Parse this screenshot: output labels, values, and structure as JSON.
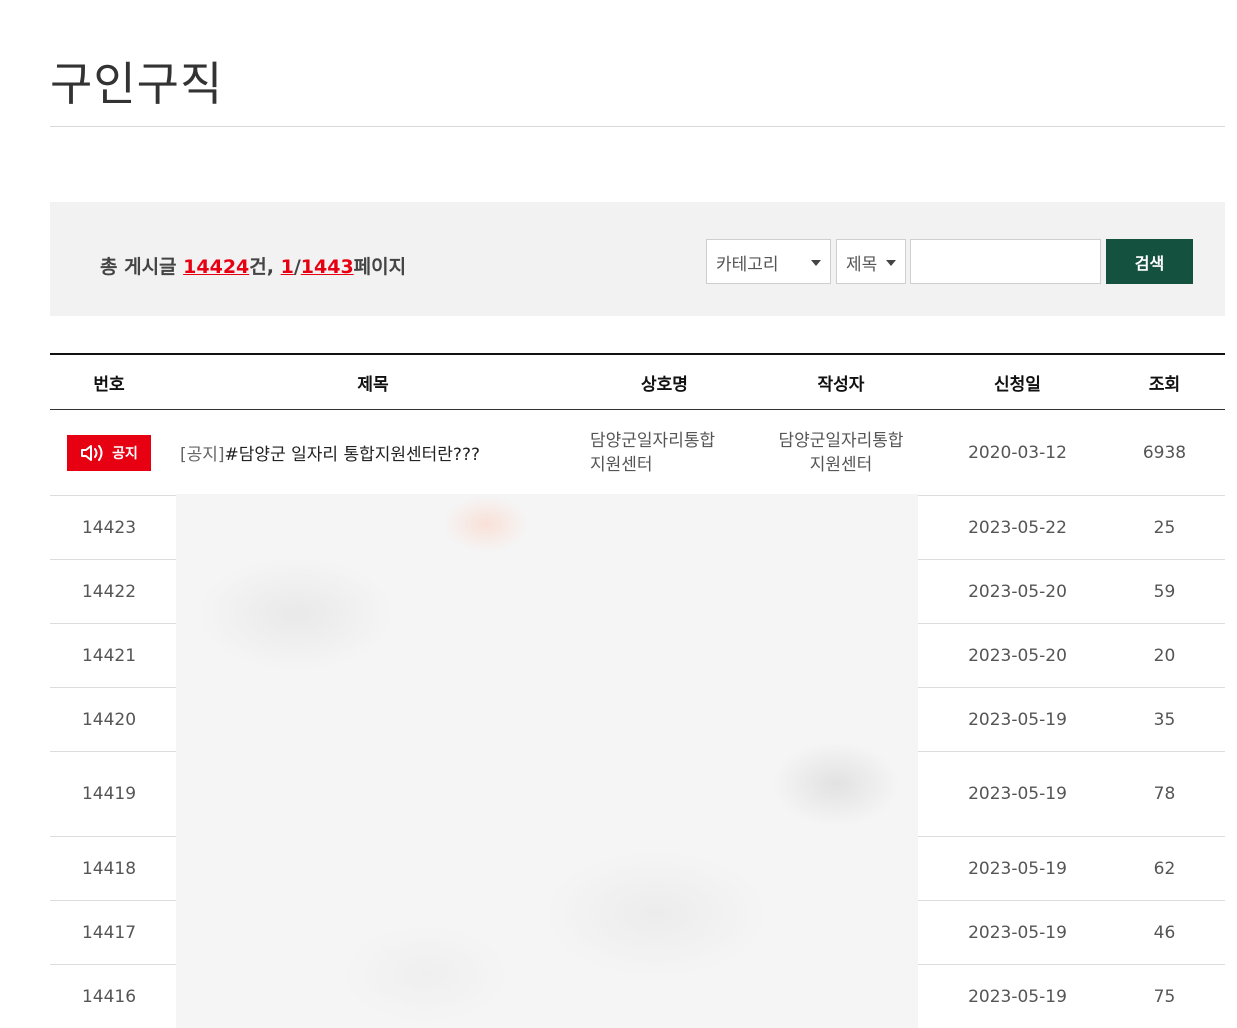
{
  "page": {
    "title": "구인구직"
  },
  "search": {
    "total_prefix": "총 게시글 ",
    "total_count": "14424",
    "total_unit": "건, ",
    "current_page": "1",
    "page_sep": "/",
    "total_pages": "1443",
    "page_suffix": "페이지",
    "category_select": "카테고리",
    "field_select": "제목",
    "input_value": "",
    "button_label": "검색"
  },
  "table": {
    "headers": [
      "번호",
      "제목",
      "상호명",
      "작성자",
      "신청일",
      "조회"
    ],
    "notice": {
      "badge": "공지",
      "tag": "[공지]",
      "title": "#담양군 일자리 통합지원센터란???",
      "company_line1": "담양군일자리통합",
      "company_line2": "지원센터",
      "writer_line1": "담양군일자리통합",
      "writer_line2": "지원센터",
      "date": "2020-03-12",
      "views": "6938"
    },
    "rows": [
      {
        "num": "14423",
        "date": "2023-05-22",
        "views": "25"
      },
      {
        "num": "14422",
        "date": "2023-05-20",
        "views": "59"
      },
      {
        "num": "14421",
        "date": "2023-05-20",
        "views": "20"
      },
      {
        "num": "14420",
        "date": "2023-05-19",
        "views": "35"
      },
      {
        "num": "14419",
        "date": "2023-05-19",
        "views": "78"
      },
      {
        "num": "14418",
        "date": "2023-05-19",
        "views": "62"
      },
      {
        "num": "14417",
        "date": "2023-05-19",
        "views": "46"
      },
      {
        "num": "14416",
        "date": "2023-05-19",
        "views": "75"
      }
    ]
  },
  "colors": {
    "accent_red": "#e60012",
    "button_green": "#14523f",
    "panel_bg": "#f2f2f2"
  },
  "icons": {
    "notice_badge_icon": "speaker-icon",
    "select_caret": "caret-down-icon"
  }
}
